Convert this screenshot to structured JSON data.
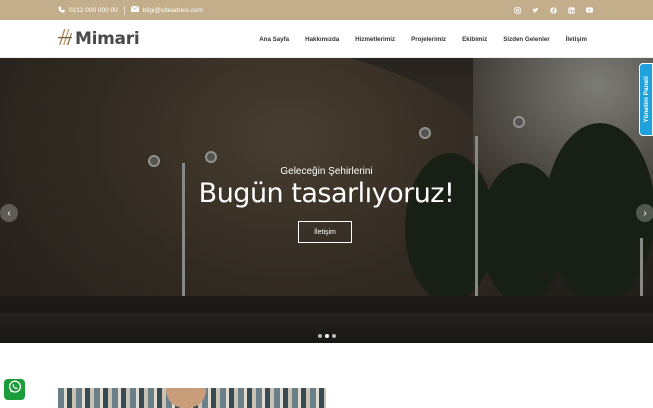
{
  "topbar": {
    "phone": "0212 000 000 00",
    "email": "bilgi@siteadresi.com",
    "socials": [
      "instagram-icon",
      "twitter-icon",
      "facebook-icon",
      "linkedin-icon",
      "youtube-icon"
    ]
  },
  "header": {
    "brand": "Mimari",
    "nav": [
      "Ana Sayfa",
      "Hakkımızda",
      "Hizmetlerimiz",
      "Projelerimiz",
      "Ekibimiz",
      "Sizden Gelenler",
      "İletişim"
    ]
  },
  "hero": {
    "subtitle": "Geleceğin Şehirlerini",
    "title": "Bugün tasarlıyoruz!",
    "cta": "İletişim",
    "slides": 3,
    "active_slide": 2
  },
  "panel_tab": "Yönetim Paneli",
  "colors": {
    "topbar": "#c2ae8a",
    "panel": "#1fa2dc",
    "whatsapp": "#1b9e3a"
  }
}
